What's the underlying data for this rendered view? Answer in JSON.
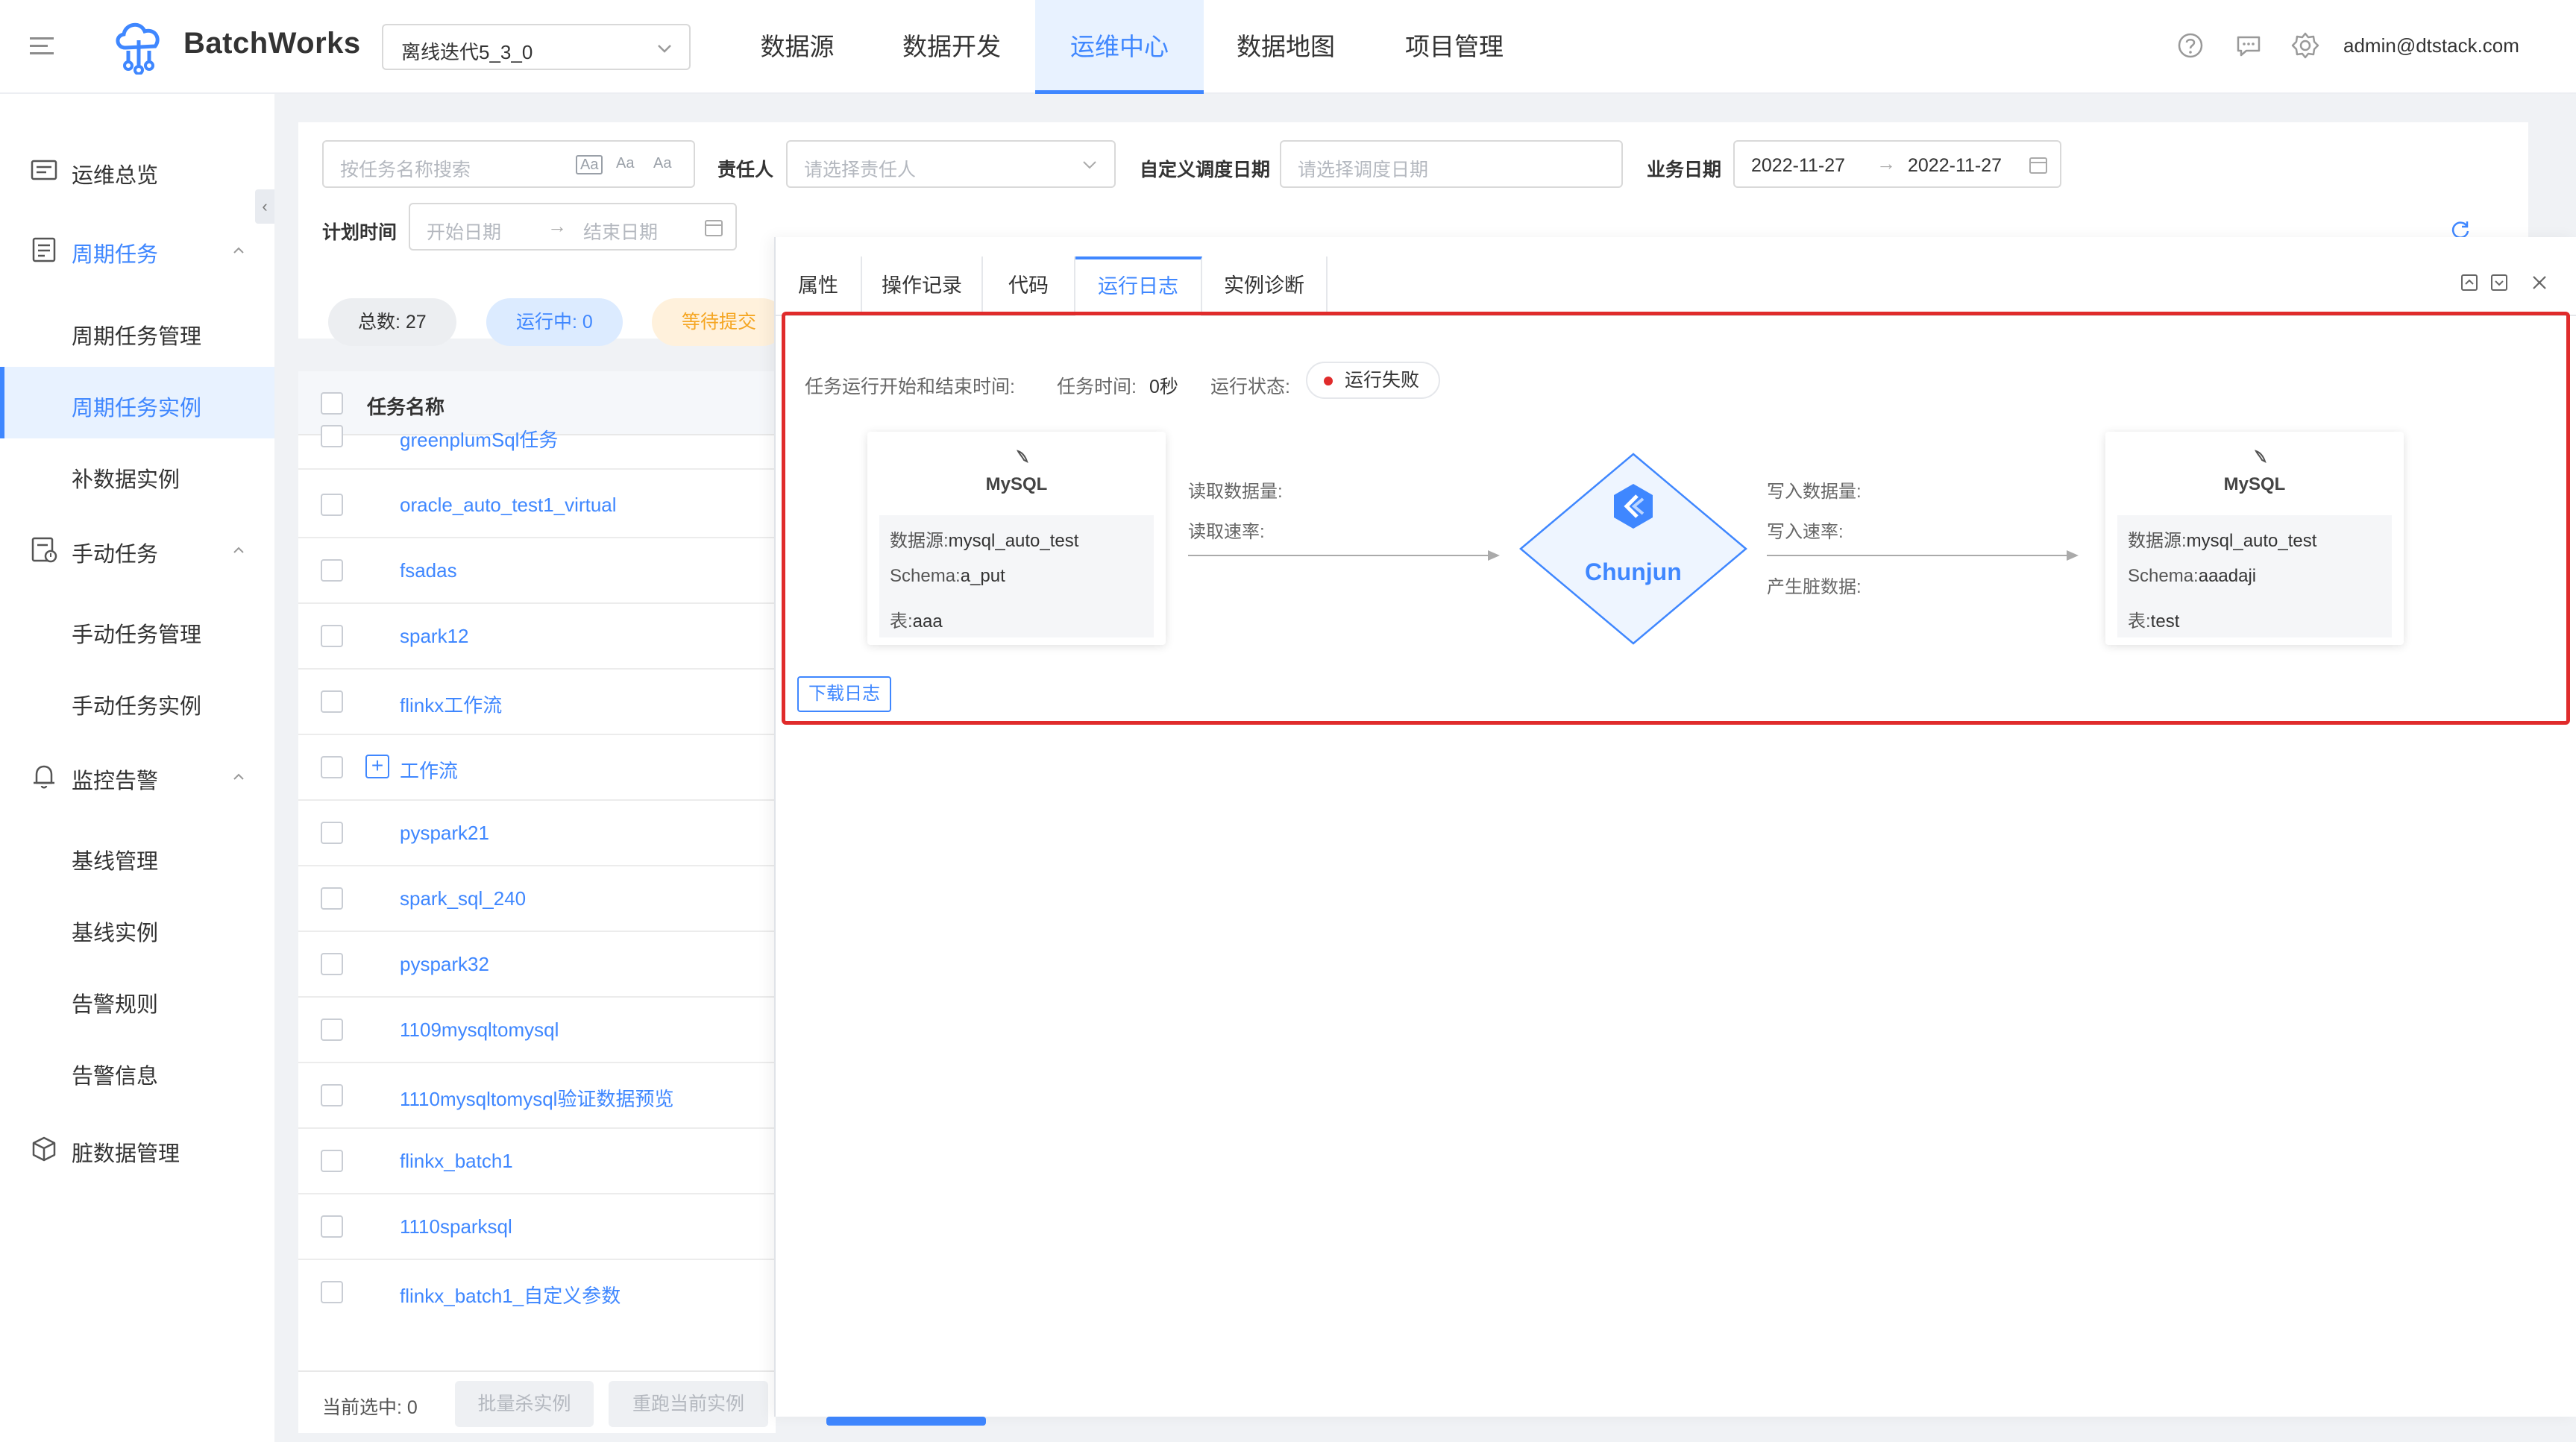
{
  "app": {
    "name": "BatchWorks",
    "project": "离线迭代5_3_0",
    "user": "admin@dtstack.com"
  },
  "nav": {
    "items": [
      {
        "label": "数据源"
      },
      {
        "label": "数据开发"
      },
      {
        "label": "运维中心"
      },
      {
        "label": "数据地图"
      },
      {
        "label": "项目管理"
      }
    ],
    "active": "运维中心"
  },
  "sidebar": {
    "overview": "运维总览",
    "periodic": "周期任务",
    "periodic_manage": "周期任务管理",
    "periodic_instance": "周期任务实例",
    "backfill_instance": "补数据实例",
    "manual": "手动任务",
    "manual_manage": "手动任务管理",
    "manual_instance": "手动任务实例",
    "monitor": "监控告警",
    "baseline_manage": "基线管理",
    "baseline_instance": "基线实例",
    "alarm_rules": "告警规则",
    "alarm_info": "告警信息",
    "dirty_data": "脏数据管理"
  },
  "filters": {
    "search_placeholder": "按任务名称搜索",
    "search_icons": [
      "Aa",
      "Aa",
      "Aa"
    ],
    "owner_label": "责任人",
    "owner_placeholder": "请选择责任人",
    "custom_date_label": "自定义调度日期",
    "custom_date_placeholder": "请选择调度日期",
    "biz_date_label": "业务日期",
    "biz_date_start": "2022-11-27",
    "biz_date_end": "2022-11-27",
    "plan_time_label": "计划时间",
    "plan_start_placeholder": "开始日期",
    "plan_end_placeholder": "结束日期"
  },
  "stats": {
    "total": "总数: 27",
    "running": "运行中: 0",
    "waiting": "等待提交"
  },
  "table": {
    "header_name": "任务名称",
    "rows": [
      {
        "name": "greenplumSql任务"
      },
      {
        "name": "oracle_auto_test1_virtual"
      },
      {
        "name": "fsadas"
      },
      {
        "name": "spark12"
      },
      {
        "name": "flinkx工作流"
      },
      {
        "name": "工作流"
      },
      {
        "name": "pyspark21"
      },
      {
        "name": "spark_sql_240"
      },
      {
        "name": "pyspark32"
      },
      {
        "name": "1109mysqltomysql"
      },
      {
        "name": "1110mysqltomysql验证数据预览"
      },
      {
        "name": "flinkx_batch1"
      },
      {
        "name": "1110sparksql"
      },
      {
        "name": "flinkx_batch1_自定义参数"
      }
    ]
  },
  "footer": {
    "selected": "当前选中: 0",
    "batch_kill": "批量杀实例",
    "rerun": "重跑当前实例"
  },
  "drawer": {
    "tabs": [
      {
        "label": "属性"
      },
      {
        "label": "操作记录"
      },
      {
        "label": "代码"
      },
      {
        "label": "运行日志"
      },
      {
        "label": "实例诊断"
      }
    ],
    "active_tab": "运行日志"
  },
  "log": {
    "start_end_label": "任务运行开始和结束时间:",
    "duration_label": "任务时间:",
    "duration_value": "0秒",
    "status_label": "运行状态:",
    "status_value": "运行失败",
    "status_color": "#e02b2b",
    "source": {
      "logo_text": "MySQL",
      "datasource_label": "数据源:",
      "datasource_value": "mysql_auto_test",
      "schema_label": "Schema:",
      "schema_value": "a_put",
      "table_label": "表:",
      "table_value": "aaa"
    },
    "read_count_label": "读取数据量:",
    "read_rate_label": "读取速率:",
    "engine": "Chunjun",
    "write_count_label": "写入数据量:",
    "write_rate_label": "写入速率:",
    "dirty_label": "产生脏数据:",
    "target": {
      "logo_text": "MySQL",
      "datasource_label": "数据源:",
      "datasource_value": "mysql_auto_test",
      "schema_label": "Schema:",
      "schema_value": "aaadaji",
      "table_label": "表:",
      "table_value": "test"
    },
    "download": "下载日志"
  },
  "colors": {
    "accent": "#3f87ff",
    "danger": "#e02b2b",
    "waiting": "#f5a623"
  }
}
